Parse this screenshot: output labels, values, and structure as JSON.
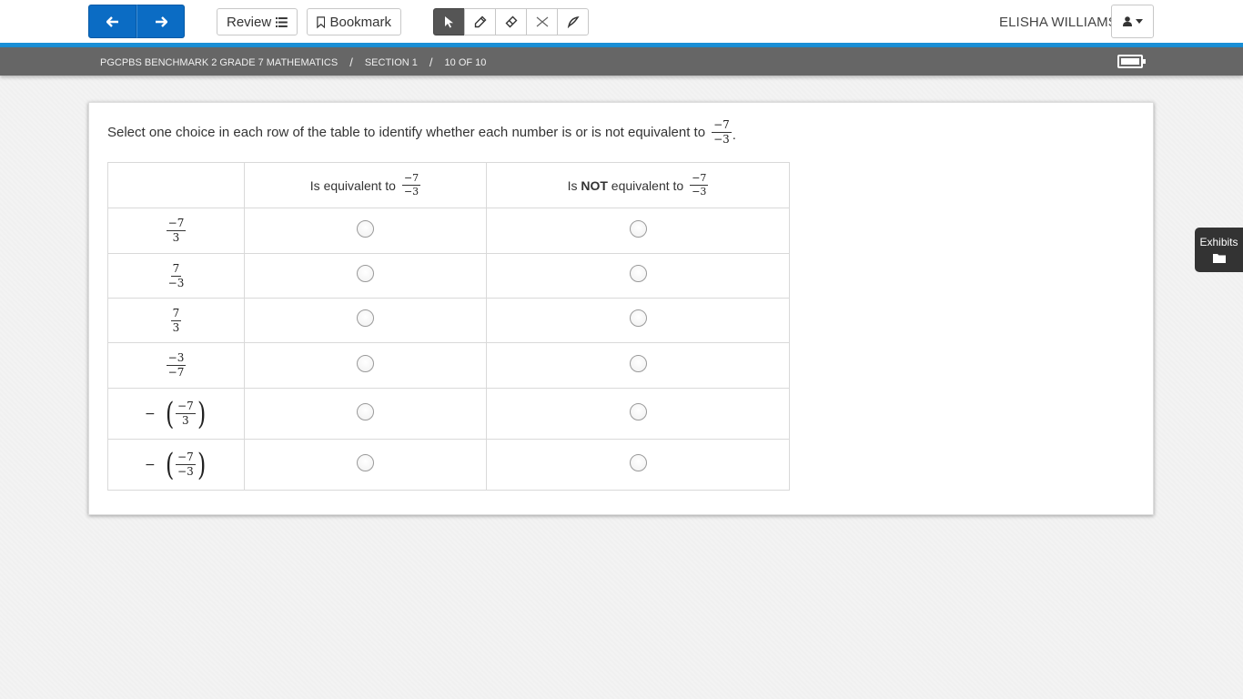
{
  "toolbar": {
    "back_icon": "arrow-left-icon",
    "forward_icon": "arrow-right-icon",
    "review_label": "Review",
    "bookmark_label": "Bookmark",
    "tools": [
      "pointer-icon",
      "highlighter-icon",
      "eraser-icon",
      "strikethrough-icon",
      "line-reader-icon"
    ],
    "active_tool": "pointer"
  },
  "user": {
    "name": "ELISHA WILLIAMS"
  },
  "breadcrumb": {
    "test": "PGCPBS BENCHMARK 2 GRADE 7 MATHEMATICS",
    "separator": "/",
    "section": "SECTION 1",
    "progress": "10 OF 10"
  },
  "question": {
    "prompt": "Select one choice in each row of the table to identify whether each number is or is not equivalent to",
    "target": {
      "num": "−7",
      "den": "−3"
    },
    "period": ".",
    "columns": [
      {
        "text": "Is equivalent to",
        "bold": "",
        "after": "",
        "num": "−7",
        "den": "−3"
      },
      {
        "text": "Is ",
        "bold": "NOT",
        "after": " equivalent to",
        "num": "−7",
        "den": "−3"
      }
    ],
    "rows": [
      {
        "neg": "",
        "num": "−7",
        "den": "3",
        "selected": null
      },
      {
        "neg": "",
        "num": "7",
        "den": "−3",
        "selected": null
      },
      {
        "neg": "",
        "num": "7",
        "den": "3",
        "selected": null
      },
      {
        "neg": "",
        "num": "−3",
        "den": "−7",
        "selected": null
      },
      {
        "neg": "−",
        "num": "−7",
        "den": "3",
        "selected": null
      },
      {
        "neg": "−",
        "num": "−7",
        "den": "−3",
        "selected": null
      }
    ]
  },
  "exhibits": {
    "label": "Exhibits"
  },
  "colors": {
    "accent": "#0b6cc4",
    "strip": "#1a8fd6",
    "crumbbar": "#666666"
  }
}
